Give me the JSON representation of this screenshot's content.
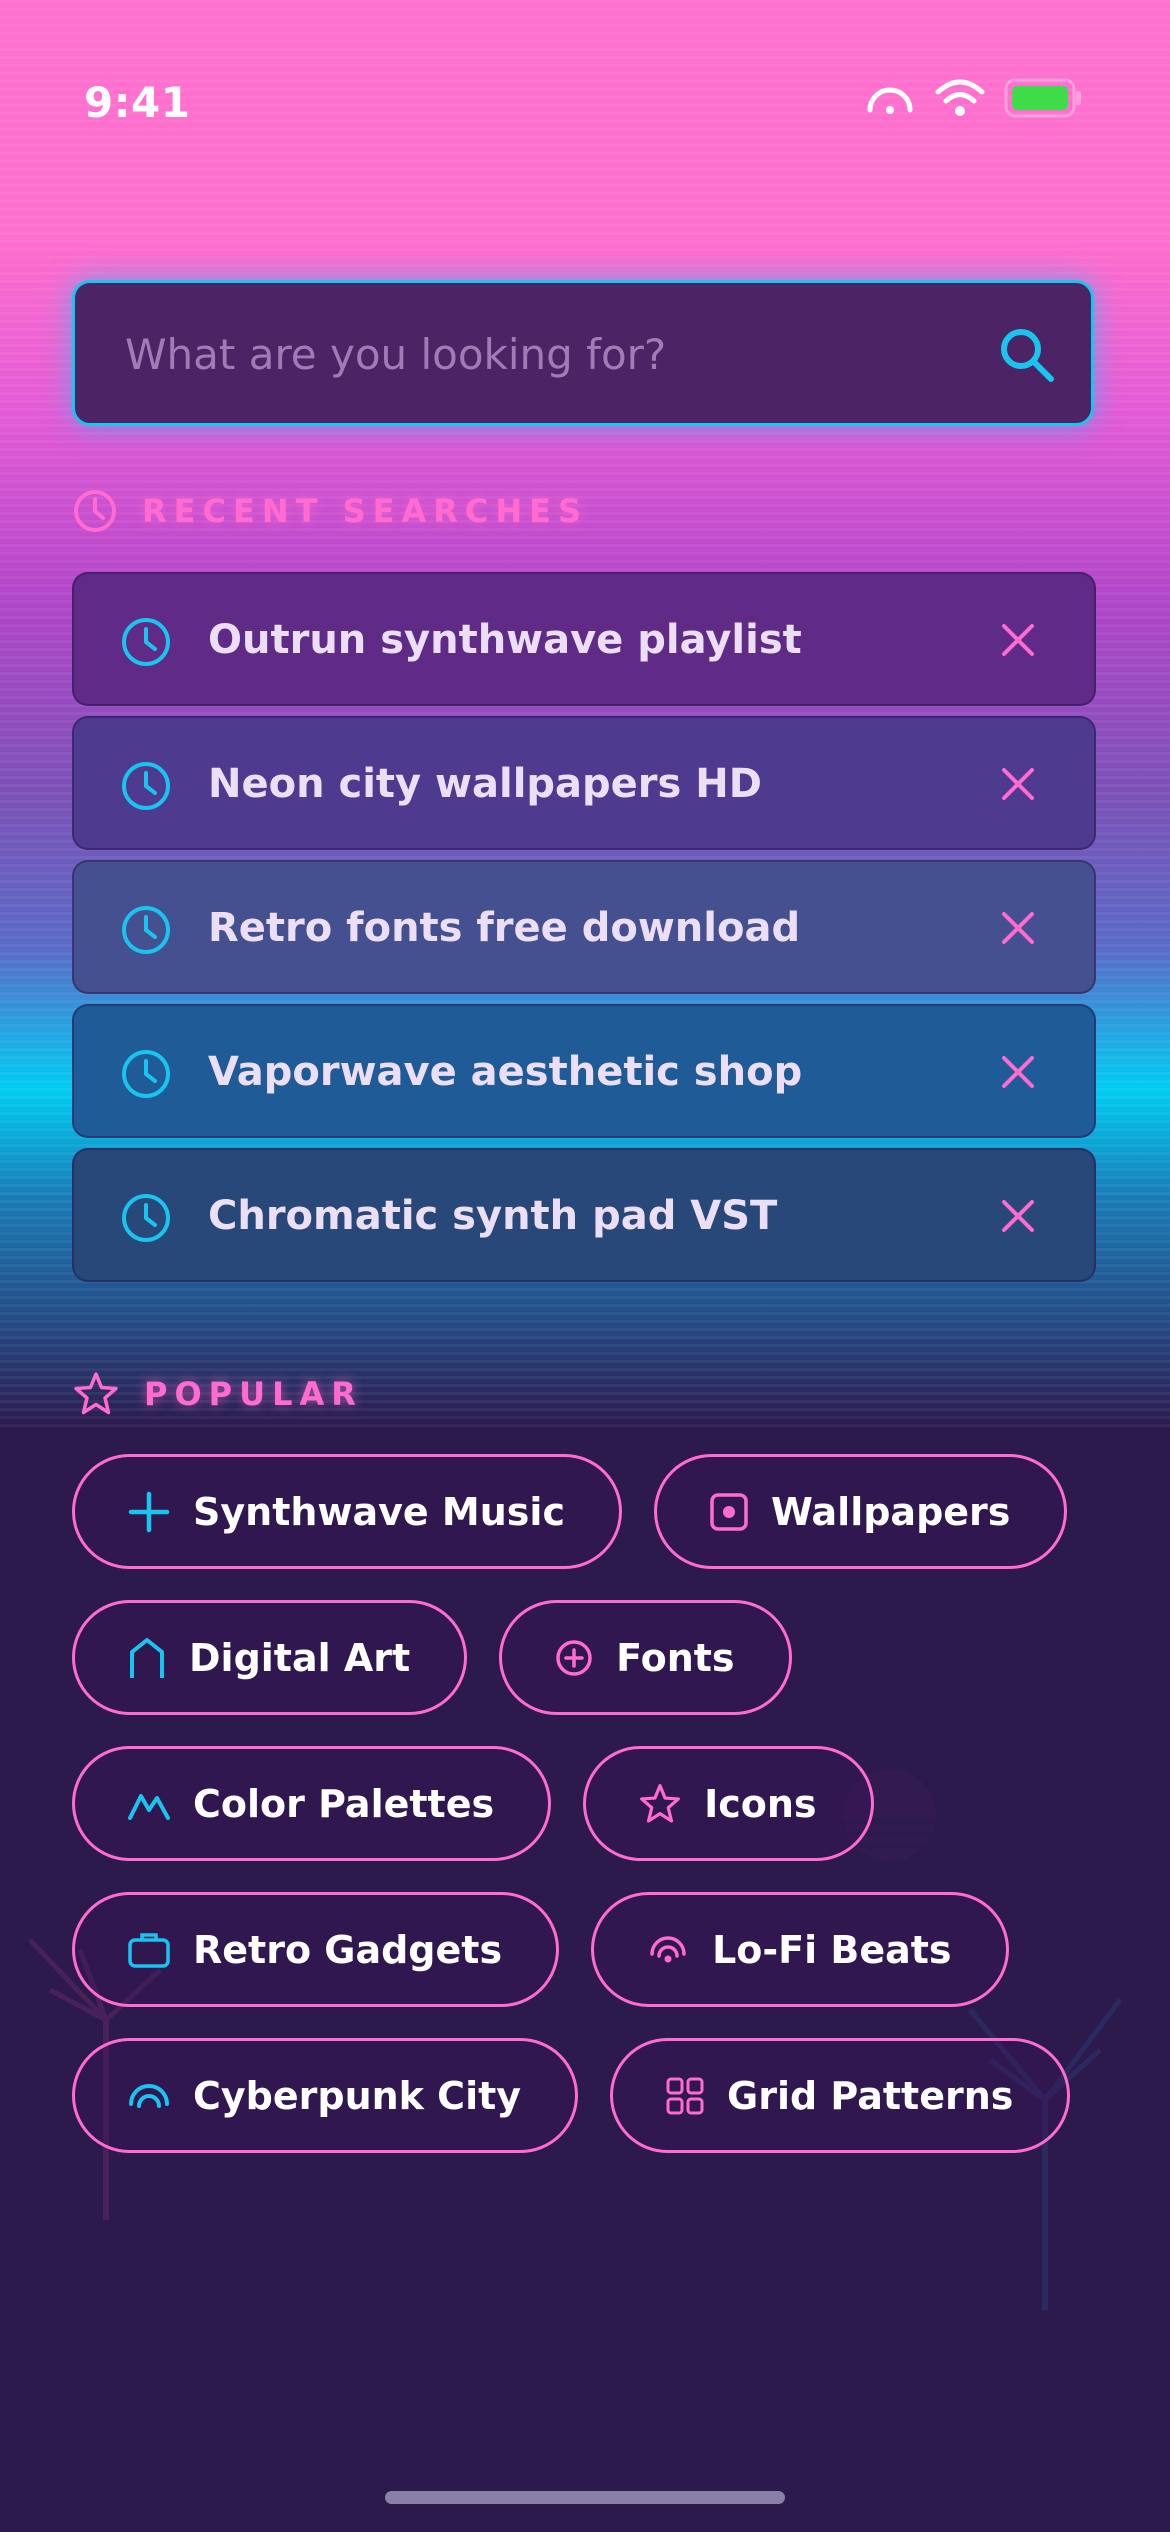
{
  "status_bar": {
    "time": "9:41"
  },
  "search": {
    "placeholder": "What are you looking for?"
  },
  "recent": {
    "heading": "RECENT SEARCHES",
    "items": [
      {
        "label": "Outrun synthwave playlist"
      },
      {
        "label": "Neon city wallpapers HD"
      },
      {
        "label": "Retro fonts free download"
      },
      {
        "label": "Vaporwave aesthetic shop"
      },
      {
        "label": "Chromatic synth pad VST"
      }
    ]
  },
  "popular": {
    "heading": "POPULAR",
    "tags": [
      {
        "label": "Synthwave Music",
        "icon": "plus-icon"
      },
      {
        "label": "Wallpapers",
        "icon": "image-square-icon"
      },
      {
        "label": "Digital Art",
        "icon": "arch-icon"
      },
      {
        "label": "Fonts",
        "icon": "plus-circle-icon"
      },
      {
        "label": "Color Palettes",
        "icon": "mountain-icon"
      },
      {
        "label": "Icons",
        "icon": "star-icon"
      },
      {
        "label": "Retro Gadgets",
        "icon": "briefcase-icon"
      },
      {
        "label": "Lo-Fi Beats",
        "icon": "radio-waves-icon"
      },
      {
        "label": "Cyberpunk City",
        "icon": "arc-icon"
      },
      {
        "label": "Grid Patterns",
        "icon": "grid-icon"
      }
    ]
  },
  "colors": {
    "accent_cyan": "#19c4ee",
    "accent_pink": "#ff6bd0",
    "background_dark": "#2c1a4c"
  }
}
